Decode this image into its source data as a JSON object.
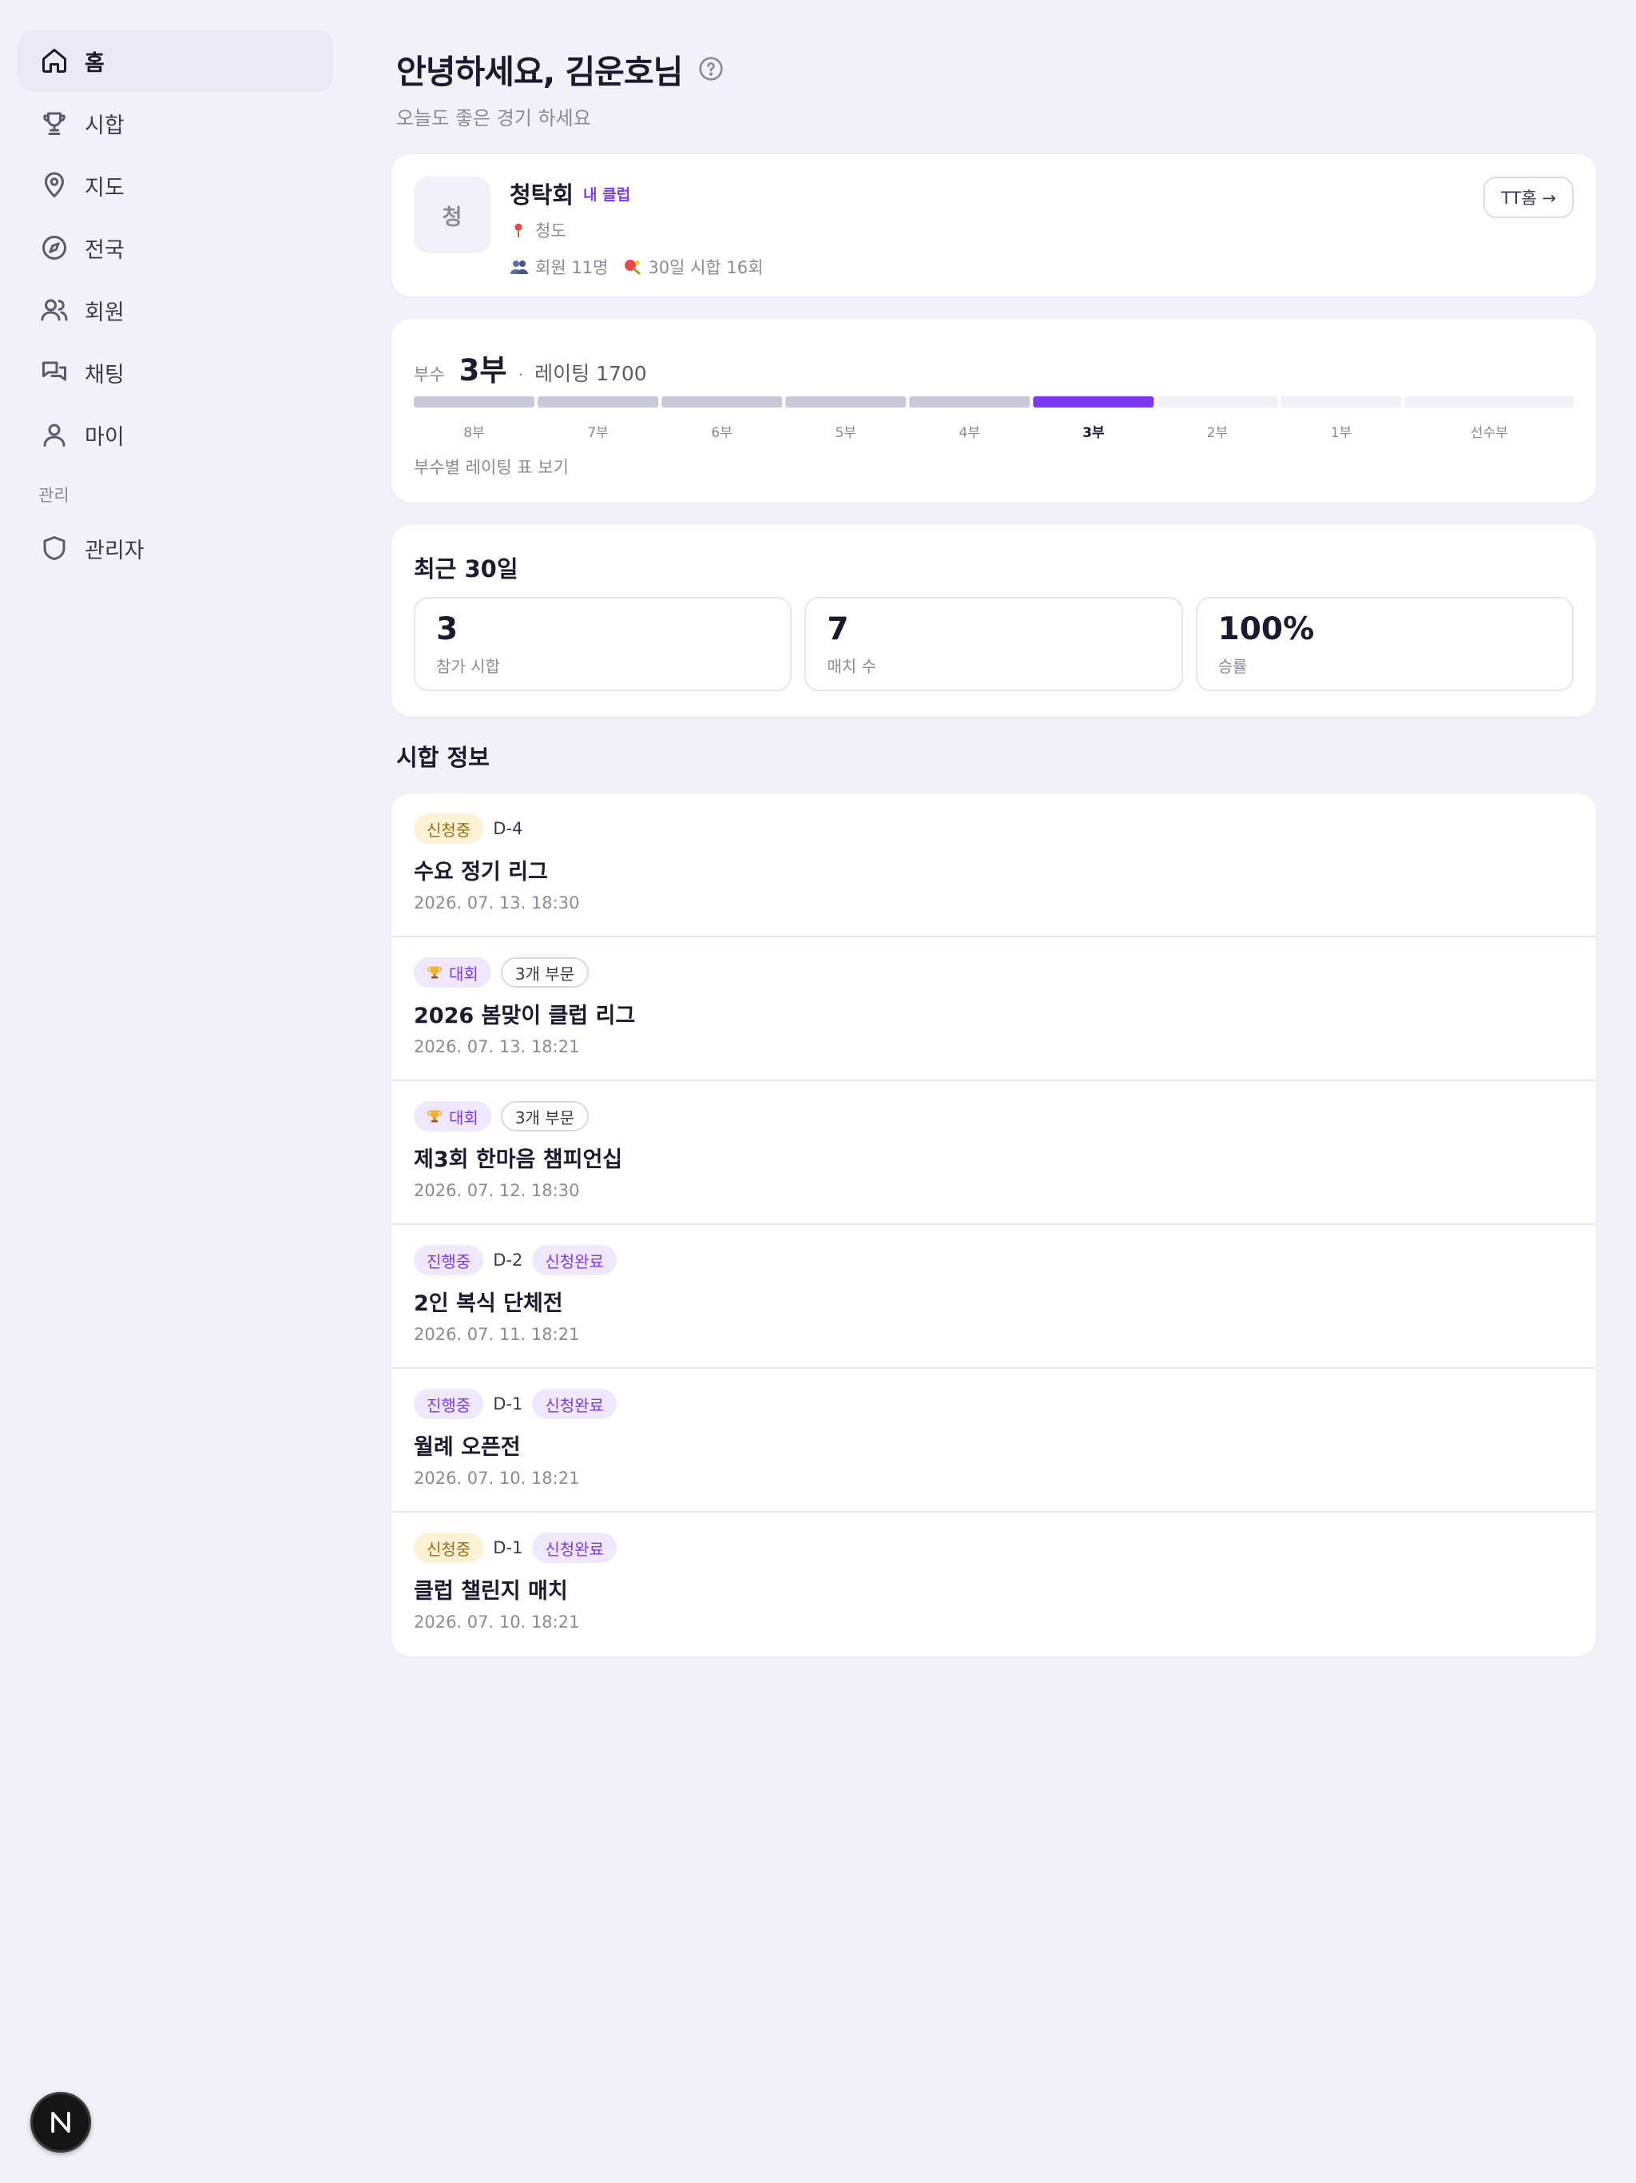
{
  "sidebar": {
    "items": [
      {
        "label": "홈",
        "icon": "home-icon",
        "active": true
      },
      {
        "label": "시합",
        "icon": "trophy-icon"
      },
      {
        "label": "지도",
        "icon": "map-pin-icon"
      },
      {
        "label": "전국",
        "icon": "compass-icon"
      },
      {
        "label": "회원",
        "icon": "users-icon"
      },
      {
        "label": "채팅",
        "icon": "chat-icon"
      },
      {
        "label": "마이",
        "icon": "user-icon"
      }
    ],
    "section_label": "관리",
    "admin_item": {
      "label": "관리자",
      "icon": "shield-icon"
    }
  },
  "header": {
    "greeting": "안녕하세요, 김운호님",
    "subtitle": "오늘도 좋은 경기 하세요"
  },
  "club": {
    "avatar_char": "청",
    "name": "청탁회",
    "badge": "내 클럽",
    "location": "청도",
    "members": "회원 11명",
    "matches": "30일 시합 16회",
    "home_button": "TT홈 →"
  },
  "division": {
    "label": "부수",
    "value": "3부",
    "rating_text": "레이팅 1700",
    "levels": [
      "8부",
      "7부",
      "6부",
      "5부",
      "4부",
      "3부",
      "2부",
      "1부",
      "선수부"
    ],
    "current_index": 5,
    "link": "부수별 레이팅 표 보기"
  },
  "recent": {
    "title": "최근 30일",
    "stats": [
      {
        "value": "3",
        "label": "참가 시합"
      },
      {
        "value": "7",
        "label": "매치 수"
      },
      {
        "value": "100%",
        "label": "승률"
      }
    ]
  },
  "events": {
    "section_title": "시합 정보",
    "items": [
      {
        "tags": [
          {
            "text": "신청중",
            "kind": "recruiting"
          }
        ],
        "dday": "D-4",
        "title": "수요 정기 리그",
        "date": "2026. 07. 13. 18:30"
      },
      {
        "tags": [
          {
            "text": "대회",
            "kind": "tourney"
          },
          {
            "text": "3개 부문",
            "kind": "outline"
          }
        ],
        "title": "2026 봄맞이 클럽 리그",
        "date": "2026. 07. 13. 18:21"
      },
      {
        "tags": [
          {
            "text": "대회",
            "kind": "tourney"
          },
          {
            "text": "3개 부문",
            "kind": "outline"
          }
        ],
        "title": "제3회 한마음 챔피언십",
        "date": "2026. 07. 12. 18:30"
      },
      {
        "tags": [
          {
            "text": "진행중",
            "kind": "ongoing"
          }
        ],
        "dday": "D-2",
        "after_tags": [
          {
            "text": "신청완료",
            "kind": "applied"
          }
        ],
        "title": "2인 복식 단체전",
        "date": "2026. 07. 11. 18:21"
      },
      {
        "tags": [
          {
            "text": "진행중",
            "kind": "ongoing"
          }
        ],
        "dday": "D-1",
        "after_tags": [
          {
            "text": "신청완료",
            "kind": "applied"
          }
        ],
        "title": "월례 오픈전",
        "date": "2026. 07. 10. 18:21"
      },
      {
        "tags": [
          {
            "text": "신청중",
            "kind": "recruiting"
          }
        ],
        "dday": "D-1",
        "after_tags": [
          {
            "text": "신청완료",
            "kind": "applied"
          }
        ],
        "title": "클럽 챌린지 매치",
        "date": "2026. 07. 10. 18:21"
      }
    ]
  },
  "floating_button": {
    "label": "N"
  },
  "colors": {
    "accent": "#7c3aed",
    "background": "#f2f1fa",
    "bar_filled": "#c9c7da",
    "bar_empty": "#f1f0f7"
  }
}
